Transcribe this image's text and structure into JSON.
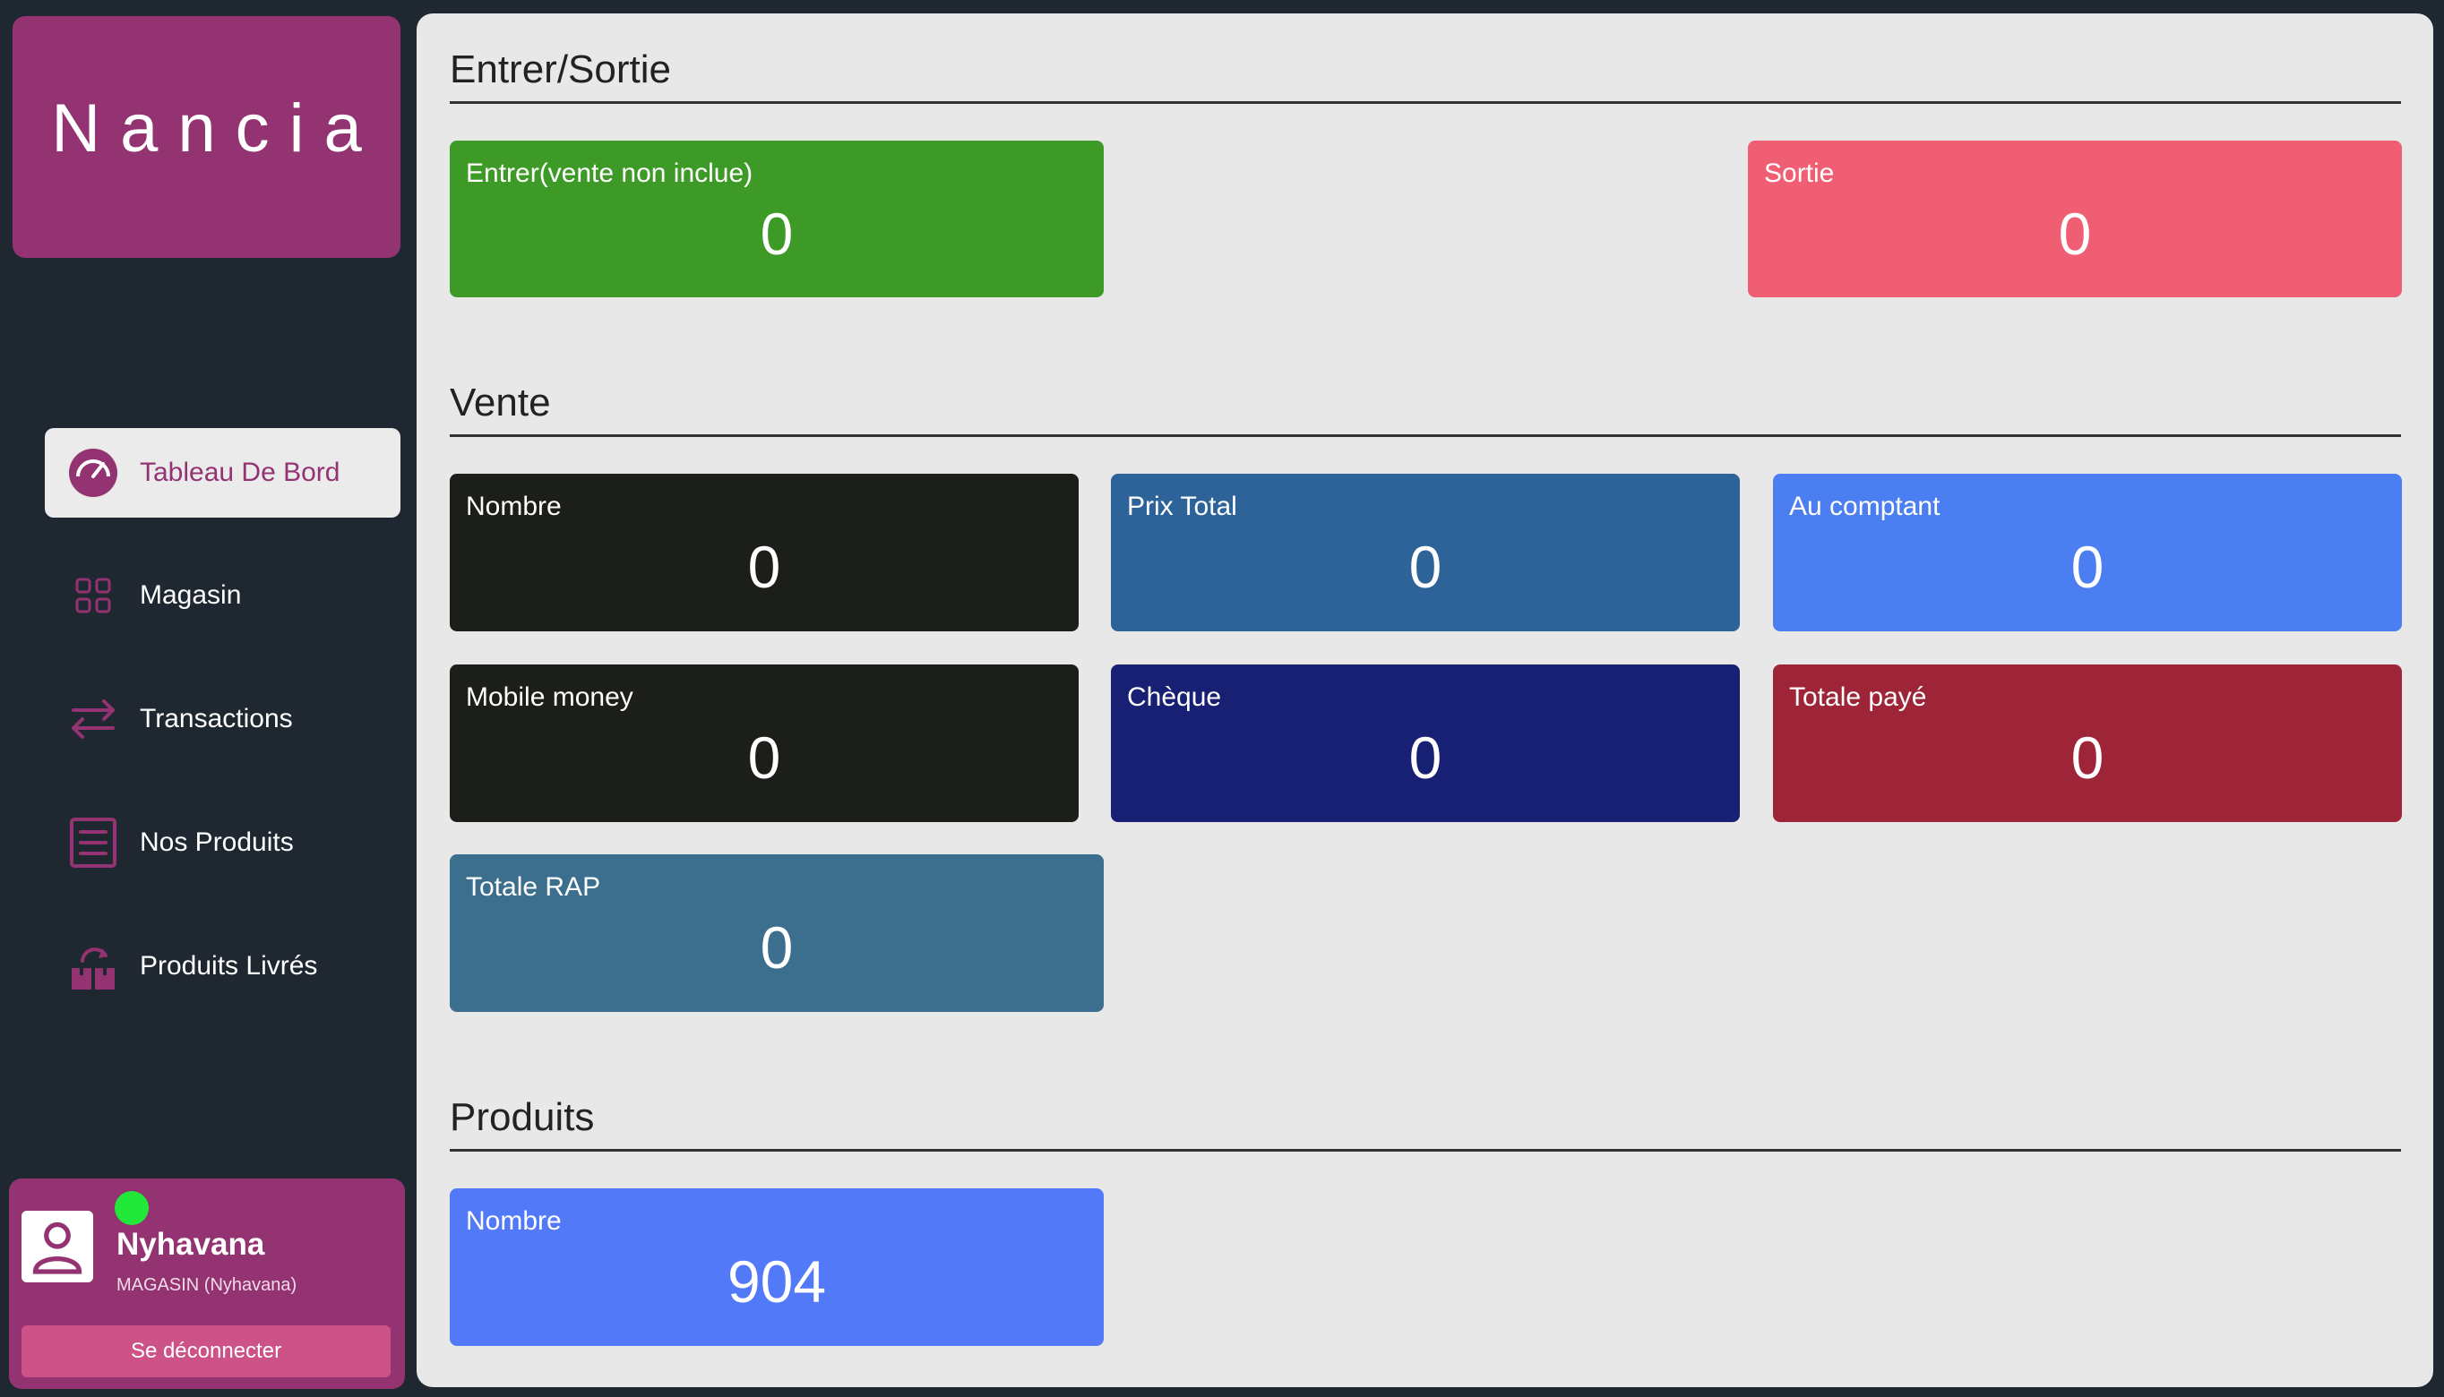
{
  "app": {
    "logo": "Nancia"
  },
  "sidebar": {
    "items": [
      {
        "label": "Tableau De Bord",
        "icon": "dashboard-gauge-icon",
        "active": true
      },
      {
        "label": "Magasin",
        "icon": "grid-icon"
      },
      {
        "label": "Transactions",
        "icon": "arrows-exchange-icon"
      },
      {
        "label": "Nos Produits",
        "icon": "list-document-icon"
      },
      {
        "label": "Produits Livrés",
        "icon": "delivery-box-icon"
      }
    ]
  },
  "user": {
    "name": "Nyhavana",
    "store": "MAGASIN (Nyhavana)",
    "status": "online",
    "logout_label": "Se déconnecter"
  },
  "sections": {
    "entrer_sortie": {
      "title": "Entrer/Sortie",
      "cards": [
        {
          "label": "Entrer(vente non inclue)",
          "value": "0",
          "color": "#3e9a27"
        },
        {
          "label": "Sortie",
          "value": "0",
          "color": "#ef5e72"
        }
      ]
    },
    "vente": {
      "title": "Vente",
      "cards": [
        {
          "label": "Nombre",
          "value": "0",
          "color": "#1c1e19"
        },
        {
          "label": "Prix Total",
          "value": "0",
          "color": "#2e6399"
        },
        {
          "label": "Au comptant",
          "value": "0",
          "color": "#4b7ef0"
        },
        {
          "label": "Mobile money",
          "value": "0",
          "color": "#1c1e19"
        },
        {
          "label": "Chèque",
          "value": "0",
          "color": "#182073"
        },
        {
          "label": "Totale payé",
          "value": "0",
          "color": "#9e2437"
        },
        {
          "label": "Totale RAP",
          "value": "0",
          "color": "#3c6f8d"
        }
      ]
    },
    "produits": {
      "title": "Produits",
      "cards": [
        {
          "label": "Nombre",
          "value": "904",
          "color": "#5279f8"
        }
      ]
    }
  }
}
